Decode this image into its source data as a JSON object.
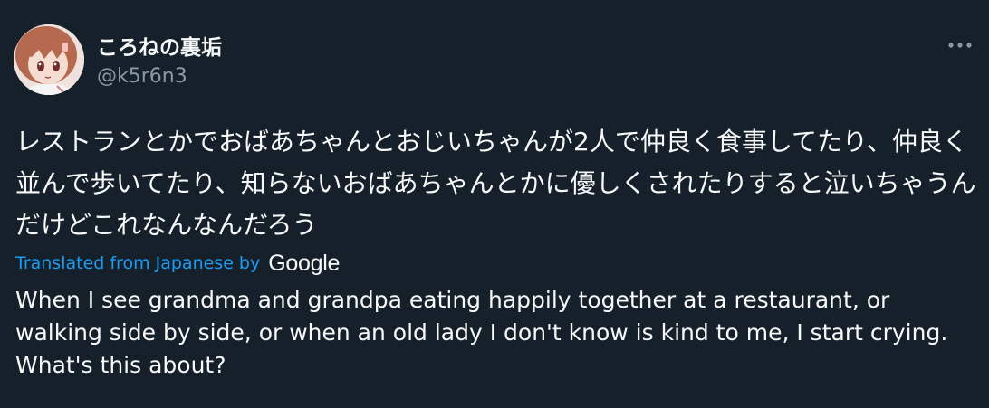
{
  "author": {
    "display_name": "ころねの裏垢",
    "handle": "@k5r6n3"
  },
  "icons": {
    "avatar": "profile-picture-anime-girl",
    "more": "more-options-horizontal-dots-icon"
  },
  "tweet": {
    "text": "レストランとかでおばあちゃんとおじいちゃんが2人で仲良く食事してたり、仲良く並んで歩いてたり、知らないおばあちゃんとかに優しくされたりすると泣いちゃうんだけどこれなんなんだろう"
  },
  "translation": {
    "label": "Translated from Japanese by",
    "provider": "Google",
    "text": "When I see grandma and grandpa eating happily together at a restaurant, or walking side by side, or when an old lady I don't know is kind to me, I start crying. What's this about?"
  },
  "colors": {
    "background": "#15202b",
    "text_primary": "#f7f9f9",
    "text_secondary": "#8b98a5",
    "link": "#1d9bf0"
  }
}
